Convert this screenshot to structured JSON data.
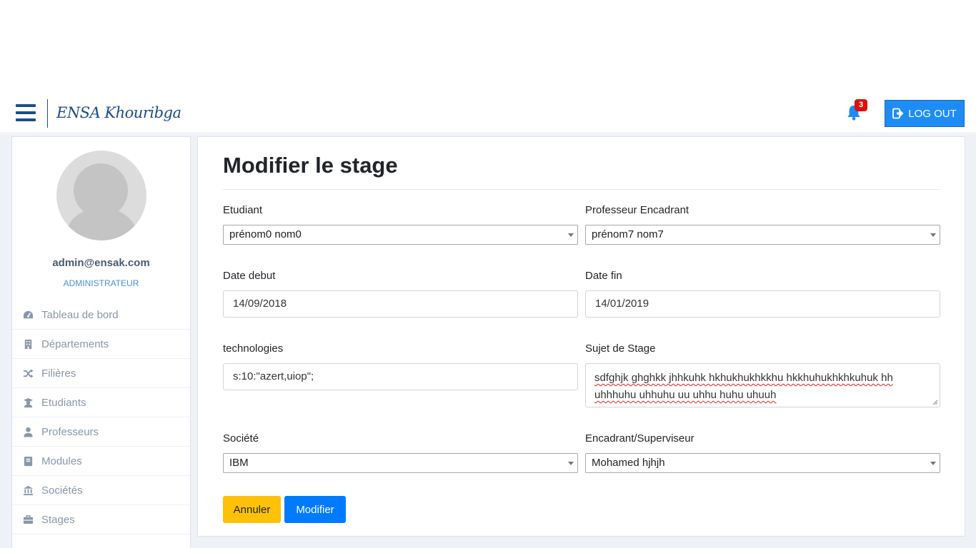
{
  "header": {
    "brand": "ENSA Khouribga",
    "notification_count": "3",
    "logout_label": "LOG OUT"
  },
  "sidebar": {
    "email": "admin@ensak.com",
    "role": "ADMINISTRATEUR",
    "items": [
      {
        "label": "Tableau de bord",
        "icon": "dashboard-icon"
      },
      {
        "label": "Départements",
        "icon": "building-icon"
      },
      {
        "label": "Filières",
        "icon": "shuffle-icon"
      },
      {
        "label": "Etudiants",
        "icon": "graduate-icon"
      },
      {
        "label": "Professeurs",
        "icon": "user-icon"
      },
      {
        "label": "Modules",
        "icon": "book-icon"
      },
      {
        "label": "Sociétés",
        "icon": "bank-icon"
      },
      {
        "label": "Stages",
        "icon": "briefcase-icon"
      }
    ]
  },
  "form": {
    "title": "Modifier le stage",
    "etudiant": {
      "label": "Etudiant",
      "value": "prénom0 nom0"
    },
    "professeur": {
      "label": "Professeur Encadrant",
      "value": "prénom7 nom7"
    },
    "date_debut": {
      "label": "Date debut",
      "value": "14/09/2018"
    },
    "date_fin": {
      "label": "Date fin",
      "value": "14/01/2019"
    },
    "technologies": {
      "label": "technologies",
      "value": "s:10:\"azert,uiop\";"
    },
    "sujet": {
      "label": "Sujet de Stage",
      "value": "sdfghjk ghghkk jhhkuhk hkhukhukhkkhu hkkhuhukhkhkuhuk hh uhhhuhu uhhuhu uu uhhu huhu uhuuh"
    },
    "societe": {
      "label": "Société",
      "value": "IBM"
    },
    "encadrant": {
      "label": "Encadrant/Superviseur",
      "value": "Mohamed hjhjh"
    },
    "cancel_label": "Annuler",
    "submit_label": "Modifier"
  },
  "colors": {
    "brand": "#1a4e8a",
    "primary": "#007bff",
    "warning": "#ffc107",
    "badge": "#e00f0f"
  }
}
